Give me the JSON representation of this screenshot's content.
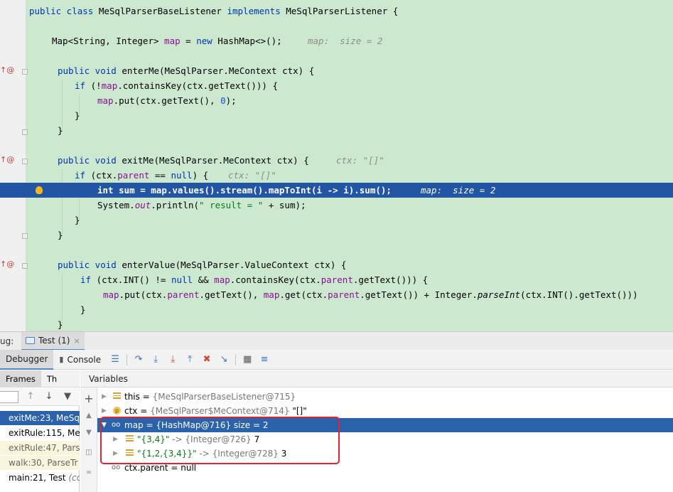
{
  "editor": {
    "class_decl": {
      "kw1": "public class",
      "name": " MeSqlParserBaseListener ",
      "kw2": "implements",
      "iface": " MeSqlParserListener {"
    },
    "map_decl": {
      "pre": "Map<String, Integer> ",
      "var": "map",
      "mid": " = ",
      "kw": "new",
      "post": " HashMap<>();",
      "hint": "map:  size = 2"
    },
    "enterMe_sig": {
      "kw": "public void",
      "rest": " enterMe(MeSqlParser.MeContext ctx) {"
    },
    "enterMe_if": {
      "kw": "if",
      "a": " (!",
      "fld": "map",
      "b": ".containsKey(ctx.getText())) {"
    },
    "enterMe_put": {
      "fld": "map",
      "a": ".put(ctx.getText(), ",
      "num": "0",
      "b": ");"
    },
    "brace_close": "}",
    "exitMe_sig": {
      "kw": "public void",
      "rest": " exitMe(MeSqlParser.MeContext ctx) {",
      "hint": "ctx: \"[]\""
    },
    "exitMe_if": {
      "kw": "if",
      "a": " (ctx.",
      "fld": "parent",
      "b": " == ",
      "kw2": "null",
      "c": ") {",
      "hint": "ctx: \"[]\""
    },
    "exec_line": {
      "kw": "int",
      "a": " sum = ",
      "fld": "map",
      "b": ".values().stream().mapToInt(i -> i).sum();",
      "hint": "map:  size = 2"
    },
    "println": {
      "a": "System.",
      "fld": "out",
      "b": ".println(",
      "str": "\" result = \"",
      "c": " + sum);"
    },
    "enterValue_sig": {
      "kw": "public void",
      "rest": " enterValue(MeSqlParser.ValueContext ctx) {"
    },
    "enterValue_if": {
      "kw": "if",
      "a": " (ctx.INT() != ",
      "kw2": "null",
      "b": " && ",
      "fld": "map",
      "c": ".containsKey(ctx.",
      "fld2": "parent",
      "d": ".getText())) {"
    },
    "enterValue_put": {
      "fld": "map",
      "a": ".put(ctx.",
      "fld2": "parent",
      "b": ".getText(), ",
      "fld3": "map",
      "c": ".get(ctx.",
      "fld4": "parent",
      "d": ".getText()) + Integer.",
      "it": "parseInt",
      "e": "(ctx.INT().getText()))"
    },
    "gutter_override": "↑@"
  },
  "debug_bar": {
    "label": "ug:",
    "tab_label": "Test (1)",
    "close": "×"
  },
  "toolbar": {
    "debugger": "Debugger",
    "console": "Console"
  },
  "frames": {
    "tab_frames": "Frames",
    "tab_threads": "Th",
    "rows": [
      {
        "text": "exitMe:23, MeSq"
      },
      {
        "text": "exitRule:115, Me"
      },
      {
        "text": "exitRule:47, Pars"
      },
      {
        "text": "walk:30, ParseTr"
      },
      {
        "text": "main:21, Test ",
        "extra": "(co"
      }
    ]
  },
  "variables": {
    "header": "Variables",
    "this": {
      "name": "this",
      "eq": " = ",
      "val": "{MeSqlParserBaseListener@715}"
    },
    "ctx": {
      "name": "ctx",
      "eq": " = ",
      "val": "{MeSqlParser$MeContext@714} ",
      "str": "\"[]\""
    },
    "map": {
      "name": "map",
      "eq": " = ",
      "val": "{HashMap@716}  size = 2"
    },
    "e1": {
      "key": "\"{3,4}\"",
      "arrow": " -> ",
      "val": "{Integer@726} ",
      "num": "7"
    },
    "e2": {
      "key": "\"{1,2,{3,4}}\"",
      "arrow": " -> ",
      "val": "{Integer@728} ",
      "num": "3"
    },
    "parent": {
      "name": "ctx.parent",
      "eq": " = ",
      "val": "null"
    }
  }
}
